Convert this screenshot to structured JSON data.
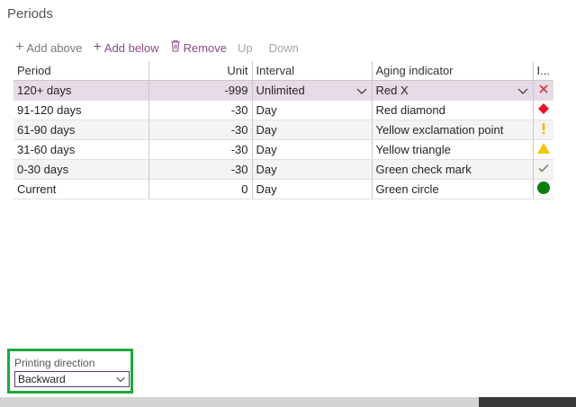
{
  "section_title": "Periods",
  "toolbar": {
    "add_above": "Add above",
    "add_below": "Add below",
    "remove": "Remove",
    "up": "Up",
    "down": "Down"
  },
  "columns": {
    "period": "Period",
    "unit": "Unit",
    "interval": "Interval",
    "aging_indicator": "Aging indicator",
    "indicator_icon": "I..."
  },
  "rows": [
    {
      "period": "120+ days",
      "unit": "-999",
      "interval": "Unlimited",
      "aging_indicator": "Red X",
      "icon": "red-x-icon",
      "icon_color": "#d13438",
      "selected": true
    },
    {
      "period": "91-120 days",
      "unit": "-30",
      "interval": "Day",
      "aging_indicator": "Red diamond",
      "icon": "red-diamond-icon",
      "icon_color": "#e81123"
    },
    {
      "period": "61-90 days",
      "unit": "-30",
      "interval": "Day",
      "aging_indicator": "Yellow exclamation point",
      "icon": "yellow-exclamation-icon",
      "icon_color": "#f2b600"
    },
    {
      "period": "31-60 days",
      "unit": "-30",
      "interval": "Day",
      "aging_indicator": "Yellow triangle",
      "icon": "yellow-triangle-icon",
      "icon_color": "#f2c500"
    },
    {
      "period": "0-30 days",
      "unit": "-30",
      "interval": "Day",
      "aging_indicator": "Green check mark",
      "icon": "green-check-icon",
      "icon_color": "#6b8f5a"
    },
    {
      "period": "Current",
      "unit": "0",
      "interval": "Day",
      "aging_indicator": "Green circle",
      "icon": "green-circle-icon",
      "icon_color": "#107c10"
    }
  ],
  "printing_direction": {
    "label": "Printing direction",
    "value": "Backward"
  },
  "colors": {
    "accent": "#8a4a8a",
    "selected_row": "#e8dbe8",
    "highlight_border": "#22a83a"
  }
}
